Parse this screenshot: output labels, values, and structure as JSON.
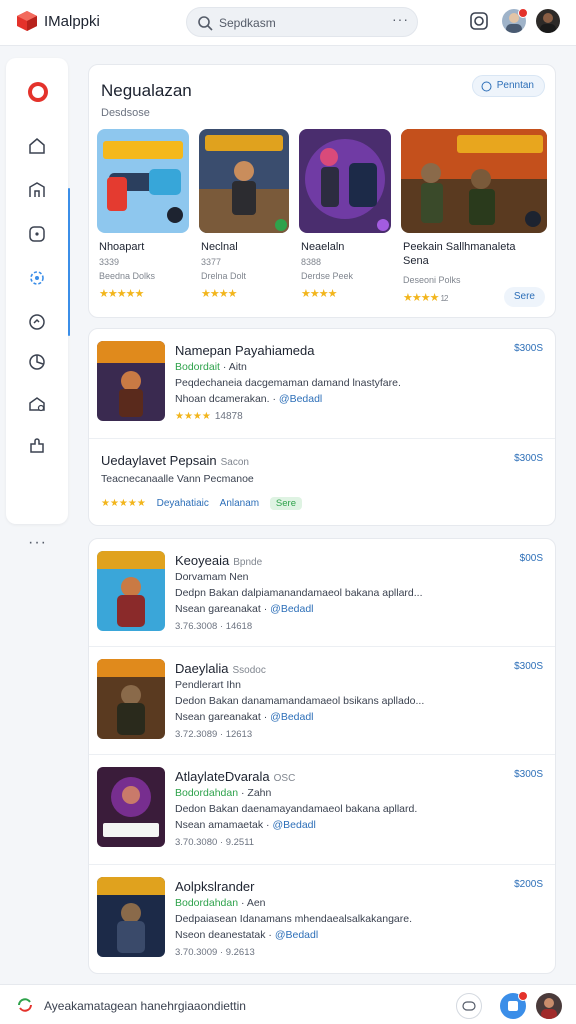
{
  "app": {
    "brand": "IMalppki"
  },
  "search": {
    "placeholder": "Sepdkasm",
    "more": "···"
  },
  "featured": {
    "title": "Negualazan",
    "subtitle": "Desdsose",
    "pill": "Penntan",
    "save_label": "Sere",
    "games": [
      {
        "name": "Nhoapart",
        "meta1": "3339",
        "meta2": "Beedna Dolks",
        "stars": "★★★★★"
      },
      {
        "name": "Neclnal",
        "meta1": "3377",
        "meta2": "Drelna Dolt",
        "stars": "★★★★"
      },
      {
        "name": "Neaelaln",
        "meta1": "8388",
        "meta2": "Derdse Peek",
        "stars": "★★★★"
      },
      {
        "name": "Peekain Sallhmanaleta",
        "name2": "Sena",
        "meta1": "",
        "meta2": "Deseoni Polks",
        "stars": "★★★★",
        "rating": "12"
      }
    ]
  },
  "list1": [
    {
      "title": "Namepan Payahiameda",
      "price": "$300S",
      "line1_green": "Bodordait",
      "line1_rest": "Aitn",
      "line2": "Peqdechaneia dacgemaman damand lnastyfare.",
      "line3": "Nhoan dcamerakan.",
      "line3_link": "@Bedadl",
      "stars": "★★★★",
      "count": "14878"
    },
    {
      "title": "Uedaylavet Pepsain",
      "title_sub": "Sacon",
      "price": "$300S",
      "line2": "Teacnecanaalle Vann Pecmanoe",
      "stars": "★★★★★",
      "link1": "Deyahatiaic",
      "link2": "Anlanam",
      "tag": "Sere"
    }
  ],
  "list2": [
    {
      "title": "Keoyeaia",
      "title_sub": "Bpnde",
      "price": "$00S",
      "line1_rest": "Dorvamam Nen",
      "line2": "Dedpn Bakan dalpiamanandamaeol bakana apllard...",
      "line3": "Nsean gareanakat",
      "line3_link": "@Bedadl",
      "meta": "3.76.3008 · 14618"
    },
    {
      "title": "Daeylalia",
      "title_sub": "Ssodoc",
      "price": "$300S",
      "line1_rest": "Pendlerart Ihn",
      "line2": "Dedon Bakan danamamandamaeol bsikans apllado...",
      "line3": "Nsean gareanakat",
      "line3_link": "@Bedadl",
      "meta": "3.72.3089 · 12613"
    },
    {
      "title": "AtlaylateDvarala",
      "title_sub": "OSC",
      "price": "$300S",
      "line1_green": "Bodordahdan",
      "line1_rest": "Zahn",
      "line2": "Dedon Bakan daenamayandamaeol bakana apllard.",
      "line3": "Nsean amamaetak",
      "line3_link": "@Bedadl",
      "meta": "3.70.3080 · 9.2511"
    },
    {
      "title": "Aolpkslrander",
      "price": "$200S",
      "line1_green": "Bodordahdan",
      "line1_rest": "Aen",
      "line2": "Dedpaiasean Idanamans mhendaealsalkakangare.",
      "line3": "Nseon deanestatak",
      "line3_link": "@Bedadl",
      "meta": "3.70.3009 · 9.2613"
    }
  ],
  "bottom": {
    "text": "Ayeakamatagean hanehrgiaaondiettin"
  },
  "colors": {
    "accent": "#2d6fb8",
    "star": "#f2b51c",
    "green": "#2ea24b",
    "logo_red": "#e4322b"
  }
}
